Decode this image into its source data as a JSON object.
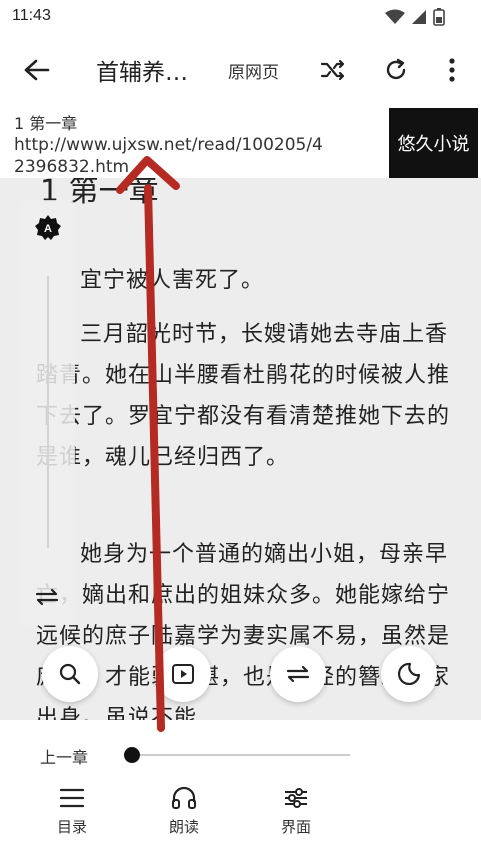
{
  "status_bar": {
    "time": "11:43",
    "icons": [
      "wifi-icon",
      "signal-icon",
      "battery-icon"
    ]
  },
  "toolbar": {
    "back_icon": "arrow-left-icon",
    "title": "首辅养…",
    "origin_label": "原网页",
    "icons": [
      "shuffle-icon",
      "refresh-icon",
      "more-vert-icon"
    ]
  },
  "chapter_info": {
    "chapter": "1 第一章",
    "url": "http://www.ujxsw.net/read/100205/42396832.htm",
    "source_button": "悠久小说"
  },
  "reader": {
    "heading": "1 第一章",
    "paragraphs": [
      "宜宁被人害死了。",
      "三月韶光时节，长嫂请她去寺庙上香踏青。她在山半腰看杜鹃花的时候被人推下去了。罗宜宁都没有看清楚推她下去的是谁，魂儿已经归西了。",
      "她身为一个普通的嫡出小姐，母亲早亡，嫡出和庶出的姐妹众多。她能嫁给宁远候的庶子陆嘉学为妻实属不易，虽然是庶出，才能弱不堪，也是正经的簪缨世家出身。虽说不能"
    ],
    "background": "#ededed"
  },
  "side_panel": {
    "icons": [
      "auto-page-icon",
      "orientation-icon"
    ]
  },
  "fabs": [
    "search-icon",
    "play-icon",
    "replace-icon",
    "night-mode-icon"
  ],
  "bottom_bar": {
    "prev_chapter": "上一章",
    "progress": 0.02,
    "nav": [
      {
        "label": "目录",
        "icon": "list-icon"
      },
      {
        "label": "朗读",
        "icon": "headphones-icon"
      },
      {
        "label": "界面",
        "icon": "sliders-icon"
      }
    ]
  },
  "colors": {
    "annotation_arrow": "#b52a22",
    "source_button_bg": "#111111"
  }
}
